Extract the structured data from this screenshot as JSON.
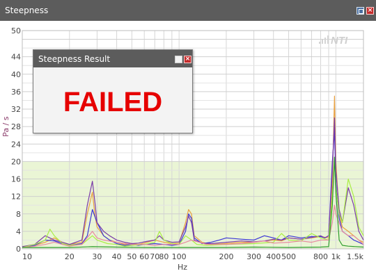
{
  "window": {
    "title": "Steepness",
    "pin_icon": "pin-icon",
    "close_icon": "close-icon"
  },
  "chart_data": {
    "type": "line",
    "xscale": "log",
    "xlim": [
      10,
      1500
    ],
    "ylim": [
      0,
      50
    ],
    "xlabel": "Hz",
    "ylabel": "Pa / s",
    "x_ticks": [
      {
        "v": 10,
        "label": "10"
      },
      {
        "v": 20,
        "label": "20"
      },
      {
        "v": 30,
        "label": "30"
      },
      {
        "v": 40,
        "label": "40"
      },
      {
        "v": 50,
        "label": "50"
      },
      {
        "v": 60,
        "label": "60"
      },
      {
        "v": 70,
        "label": "70"
      },
      {
        "v": 80,
        "label": "80"
      },
      {
        "v": 100,
        "label": "100"
      },
      {
        "v": 200,
        "label": "200"
      },
      {
        "v": 300,
        "label": "300"
      },
      {
        "v": 400,
        "label": "400"
      },
      {
        "v": 500,
        "label": "500"
      },
      {
        "v": 800,
        "label": "800"
      },
      {
        "v": 1000,
        "label": "1k"
      },
      {
        "v": 1500,
        "label": "1.5k"
      }
    ],
    "y_ticks": [
      0,
      4,
      8,
      12,
      16,
      20,
      24,
      28,
      32,
      36,
      40,
      44,
      50
    ],
    "threshold_band": {
      "from": 0,
      "to": 20,
      "color": "#eaf5d5"
    },
    "grid": true,
    "logo": "NTI",
    "series": [
      {
        "color": "#e8a040",
        "points": [
          [
            10,
            0.5
          ],
          [
            12,
            0.8
          ],
          [
            14,
            1.5
          ],
          [
            16,
            2.5
          ],
          [
            18,
            1.5
          ],
          [
            20,
            1.0
          ],
          [
            24,
            1.5
          ],
          [
            26,
            8
          ],
          [
            28,
            13
          ],
          [
            29,
            8
          ],
          [
            30,
            5
          ],
          [
            33,
            3
          ],
          [
            36,
            2
          ],
          [
            40,
            1.5
          ],
          [
            45,
            1.0
          ],
          [
            50,
            1.2
          ],
          [
            55,
            1.0
          ],
          [
            60,
            1.3
          ],
          [
            70,
            2
          ],
          [
            80,
            1.5
          ],
          [
            90,
            1.2
          ],
          [
            100,
            1.3
          ],
          [
            110,
            6
          ],
          [
            115,
            9
          ],
          [
            120,
            8
          ],
          [
            125,
            3
          ],
          [
            140,
            1.5
          ],
          [
            160,
            1.0
          ],
          [
            200,
            1.2
          ],
          [
            250,
            1.5
          ],
          [
            300,
            1.5
          ],
          [
            350,
            1.8
          ],
          [
            400,
            2
          ],
          [
            450,
            1.8
          ],
          [
            500,
            2.5
          ],
          [
            600,
            2.2
          ],
          [
            700,
            2.5
          ],
          [
            800,
            2.8
          ],
          [
            900,
            2.5
          ],
          [
            950,
            15
          ],
          [
            980,
            35
          ],
          [
            1000,
            20
          ],
          [
            1050,
            8
          ],
          [
            1100,
            5
          ],
          [
            1200,
            4
          ],
          [
            1300,
            3
          ],
          [
            1400,
            2
          ],
          [
            1500,
            1.5
          ]
        ]
      },
      {
        "color": "#3c36d6",
        "points": [
          [
            10,
            0.3
          ],
          [
            12,
            0.8
          ],
          [
            14,
            2
          ],
          [
            16,
            1.8
          ],
          [
            18,
            1.2
          ],
          [
            20,
            0.8
          ],
          [
            24,
            1.2
          ],
          [
            26,
            3
          ],
          [
            28,
            9
          ],
          [
            30,
            6
          ],
          [
            33,
            3
          ],
          [
            36,
            2
          ],
          [
            40,
            1.2
          ],
          [
            45,
            0.8
          ],
          [
            50,
            1
          ],
          [
            55,
            0.8
          ],
          [
            60,
            1
          ],
          [
            70,
            1.2
          ],
          [
            80,
            1
          ],
          [
            90,
            0.8
          ],
          [
            100,
            1
          ],
          [
            110,
            4
          ],
          [
            115,
            8
          ],
          [
            120,
            7
          ],
          [
            125,
            2.5
          ],
          [
            140,
            1.2
          ],
          [
            160,
            1.5
          ],
          [
            180,
            2
          ],
          [
            200,
            2.5
          ],
          [
            250,
            2.2
          ],
          [
            300,
            2
          ],
          [
            350,
            3
          ],
          [
            400,
            2.5
          ],
          [
            450,
            2
          ],
          [
            500,
            3
          ],
          [
            600,
            2.5
          ],
          [
            700,
            2.8
          ],
          [
            800,
            2.8
          ],
          [
            850,
            2.5
          ],
          [
            900,
            3
          ],
          [
            950,
            20
          ],
          [
            980,
            27
          ],
          [
            1000,
            15
          ],
          [
            1050,
            7
          ],
          [
            1100,
            4
          ],
          [
            1200,
            3
          ],
          [
            1300,
            2
          ],
          [
            1400,
            1.5
          ],
          [
            1500,
            1
          ]
        ]
      },
      {
        "color": "#7a3aa8",
        "points": [
          [
            10,
            0.5
          ],
          [
            12,
            1.0
          ],
          [
            14,
            3
          ],
          [
            16,
            2
          ],
          [
            18,
            1.5
          ],
          [
            20,
            1.0
          ],
          [
            24,
            2
          ],
          [
            26,
            10
          ],
          [
            28,
            15.5
          ],
          [
            29,
            11
          ],
          [
            30,
            6
          ],
          [
            33,
            4
          ],
          [
            36,
            3
          ],
          [
            40,
            2
          ],
          [
            45,
            1.5
          ],
          [
            50,
            1.2
          ],
          [
            55,
            1.3
          ],
          [
            60,
            1.6
          ],
          [
            70,
            2
          ],
          [
            75,
            3
          ],
          [
            80,
            2
          ],
          [
            90,
            1.5
          ],
          [
            100,
            1.6
          ],
          [
            110,
            5
          ],
          [
            115,
            7.5
          ],
          [
            120,
            6
          ],
          [
            125,
            2
          ],
          [
            140,
            1.3
          ],
          [
            160,
            1.2
          ],
          [
            200,
            1.5
          ],
          [
            250,
            1.8
          ],
          [
            300,
            1.6
          ],
          [
            350,
            1.8
          ],
          [
            400,
            2.2
          ],
          [
            450,
            2
          ],
          [
            500,
            2.5
          ],
          [
            600,
            2.2
          ],
          [
            700,
            2.6
          ],
          [
            800,
            3
          ],
          [
            850,
            2.5
          ],
          [
            900,
            3
          ],
          [
            950,
            18
          ],
          [
            980,
            30
          ],
          [
            1000,
            18
          ],
          [
            1050,
            9
          ],
          [
            1100,
            6
          ],
          [
            1200,
            14
          ],
          [
            1300,
            10
          ],
          [
            1400,
            4
          ],
          [
            1500,
            2
          ]
        ]
      },
      {
        "color": "#aaee44",
        "points": [
          [
            10,
            0.3
          ],
          [
            12,
            1
          ],
          [
            14,
            2
          ],
          [
            15,
            4.5
          ],
          [
            16,
            3
          ],
          [
            18,
            1.2
          ],
          [
            20,
            0.8
          ],
          [
            24,
            1
          ],
          [
            28,
            3
          ],
          [
            30,
            2
          ],
          [
            35,
            1.2
          ],
          [
            40,
            1
          ],
          [
            45,
            0.6
          ],
          [
            50,
            0.8
          ],
          [
            60,
            1
          ],
          [
            70,
            1.5
          ],
          [
            75,
            4
          ],
          [
            80,
            2
          ],
          [
            90,
            1.2
          ],
          [
            100,
            1
          ],
          [
            110,
            3
          ],
          [
            120,
            2
          ],
          [
            130,
            1
          ],
          [
            150,
            0.8
          ],
          [
            200,
            1
          ],
          [
            300,
            1.2
          ],
          [
            400,
            1.5
          ],
          [
            450,
            3.5
          ],
          [
            500,
            2
          ],
          [
            600,
            1.8
          ],
          [
            700,
            3.5
          ],
          [
            800,
            2.5
          ],
          [
            900,
            2
          ],
          [
            950,
            12
          ],
          [
            980,
            20
          ],
          [
            1000,
            14
          ],
          [
            1050,
            8
          ],
          [
            1100,
            6
          ],
          [
            1200,
            16
          ],
          [
            1300,
            12
          ],
          [
            1400,
            5
          ],
          [
            1500,
            3
          ]
        ]
      },
      {
        "color": "#e888a0",
        "points": [
          [
            10,
            0.3
          ],
          [
            12,
            0.6
          ],
          [
            14,
            1
          ],
          [
            16,
            1.5
          ],
          [
            18,
            1
          ],
          [
            20,
            0.6
          ],
          [
            24,
            1
          ],
          [
            28,
            4
          ],
          [
            30,
            2.5
          ],
          [
            33,
            2
          ],
          [
            40,
            1.5
          ],
          [
            50,
            1
          ],
          [
            60,
            1
          ],
          [
            70,
            0.8
          ],
          [
            80,
            1
          ],
          [
            100,
            1
          ],
          [
            110,
            1.5
          ],
          [
            120,
            2
          ],
          [
            150,
            1
          ],
          [
            200,
            1
          ],
          [
            250,
            1.2
          ],
          [
            300,
            1.5
          ],
          [
            350,
            1.8
          ],
          [
            400,
            1.3
          ],
          [
            500,
            1.5
          ],
          [
            600,
            1.8
          ],
          [
            700,
            1.5
          ],
          [
            800,
            2
          ],
          [
            900,
            2
          ],
          [
            950,
            6
          ],
          [
            980,
            10
          ],
          [
            1000,
            8
          ],
          [
            1100,
            4
          ],
          [
            1200,
            3
          ],
          [
            1300,
            3
          ],
          [
            1400,
            2
          ],
          [
            1500,
            1
          ]
        ]
      },
      {
        "color": "#2e9d2e",
        "points": [
          [
            10,
            0.3
          ],
          [
            20,
            0.3
          ],
          [
            28,
            0.5
          ],
          [
            40,
            0.4
          ],
          [
            60,
            0.3
          ],
          [
            100,
            0.3
          ],
          [
            200,
            0.3
          ],
          [
            300,
            0.4
          ],
          [
            500,
            0.3
          ],
          [
            800,
            0.4
          ],
          [
            900,
            0.5
          ],
          [
            950,
            10
          ],
          [
            980,
            21
          ],
          [
            1000,
            13
          ],
          [
            1050,
            2
          ],
          [
            1100,
            0.8
          ],
          [
            1200,
            0.6
          ],
          [
            1500,
            0.4
          ]
        ]
      }
    ]
  },
  "dialog": {
    "title": "Steepness Result",
    "maximize_icon": "maximize-icon",
    "close_icon": "close-icon",
    "result": "FAILED"
  }
}
